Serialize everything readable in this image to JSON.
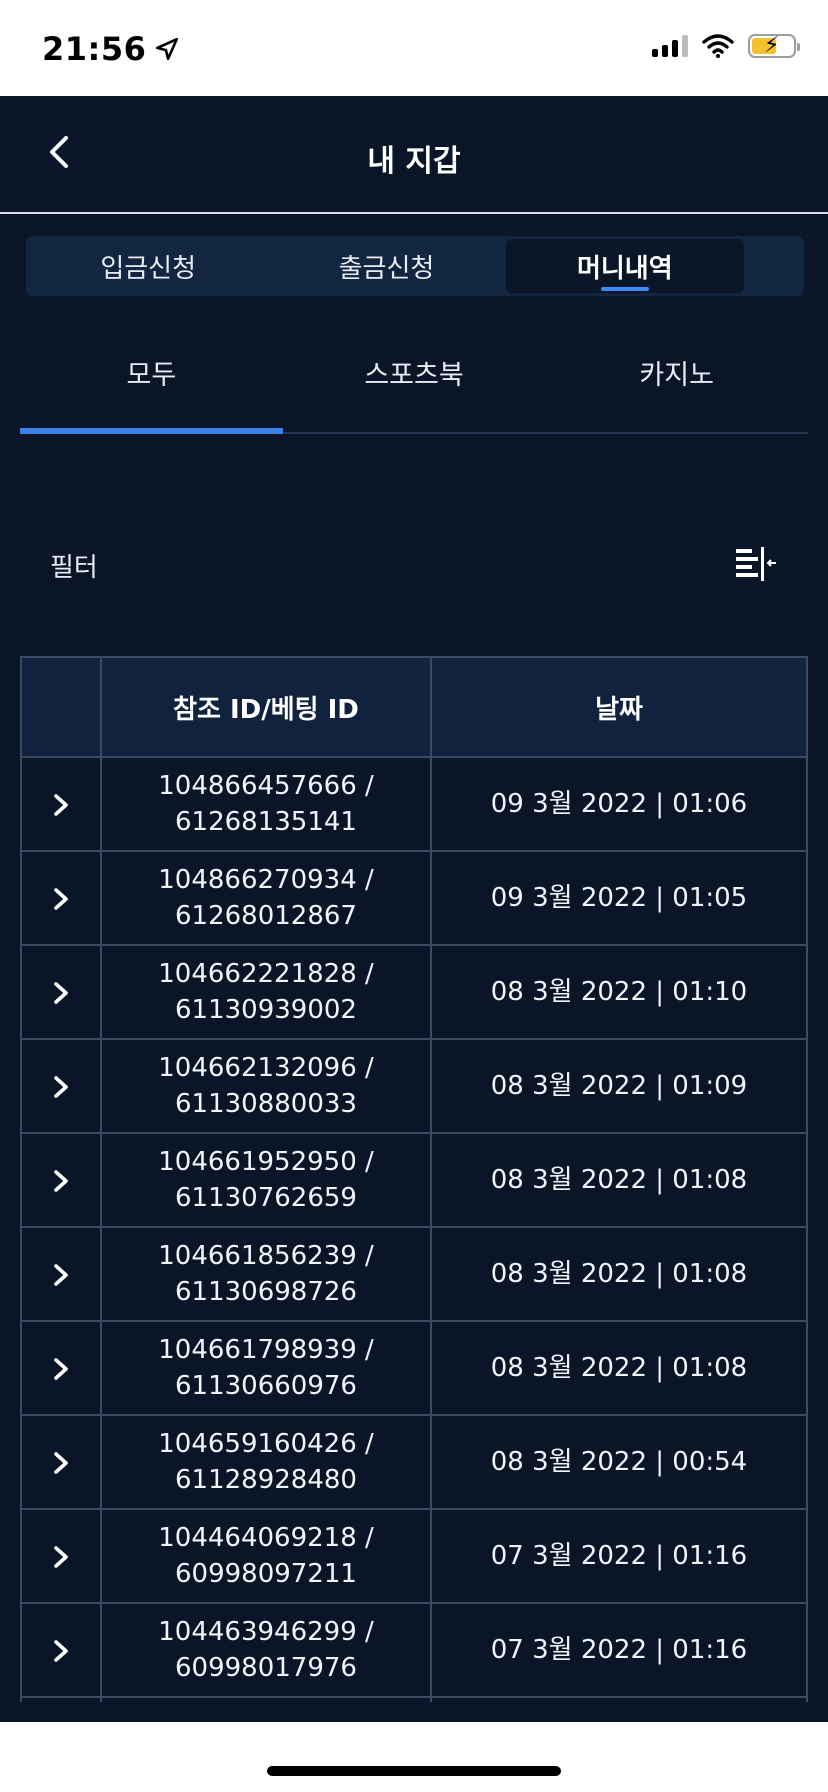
{
  "status": {
    "time": "21:56"
  },
  "header": {
    "title": "내 지갑"
  },
  "segments": [
    {
      "label": "입금신청",
      "active": false
    },
    {
      "label": "출금신청",
      "active": false
    },
    {
      "label": "머니내역",
      "active": true
    }
  ],
  "sub_tabs": [
    {
      "label": "모두",
      "active": true
    },
    {
      "label": "스포츠북",
      "active": false
    },
    {
      "label": "카지노",
      "active": false
    }
  ],
  "filter": {
    "label": "필터"
  },
  "table": {
    "headers": {
      "ref": "참조 ID/베팅 ID",
      "date": "날짜"
    },
    "rows": [
      {
        "ref": "104866457666 /",
        "bet": "61268135141",
        "date": "09 3월 2022 | 01:06"
      },
      {
        "ref": "104866270934 /",
        "bet": "61268012867",
        "date": "09 3월 2022 | 01:05"
      },
      {
        "ref": "104662221828 /",
        "bet": "61130939002",
        "date": "08 3월 2022 | 01:10"
      },
      {
        "ref": "104662132096 /",
        "bet": "61130880033",
        "date": "08 3월 2022 | 01:09"
      },
      {
        "ref": "104661952950 /",
        "bet": "61130762659",
        "date": "08 3월 2022 | 01:08"
      },
      {
        "ref": "104661856239 /",
        "bet": "61130698726",
        "date": "08 3월 2022 | 01:08"
      },
      {
        "ref": "104661798939 /",
        "bet": "61130660976",
        "date": "08 3월 2022 | 01:08"
      },
      {
        "ref": "104659160426 /",
        "bet": "61128928480",
        "date": "08 3월 2022 | 00:54"
      },
      {
        "ref": "104464069218 /",
        "bet": "60998097211",
        "date": "07 3월 2022 | 01:16"
      },
      {
        "ref": "104463946299 /",
        "bet": "60998017976",
        "date": "07 3월 2022 | 01:16"
      },
      {
        "ref": "",
        "bet": "",
        "date": ""
      }
    ]
  },
  "colors": {
    "background": "#0a1628",
    "accent": "#3d7fe6",
    "header_row": "#10223d"
  }
}
